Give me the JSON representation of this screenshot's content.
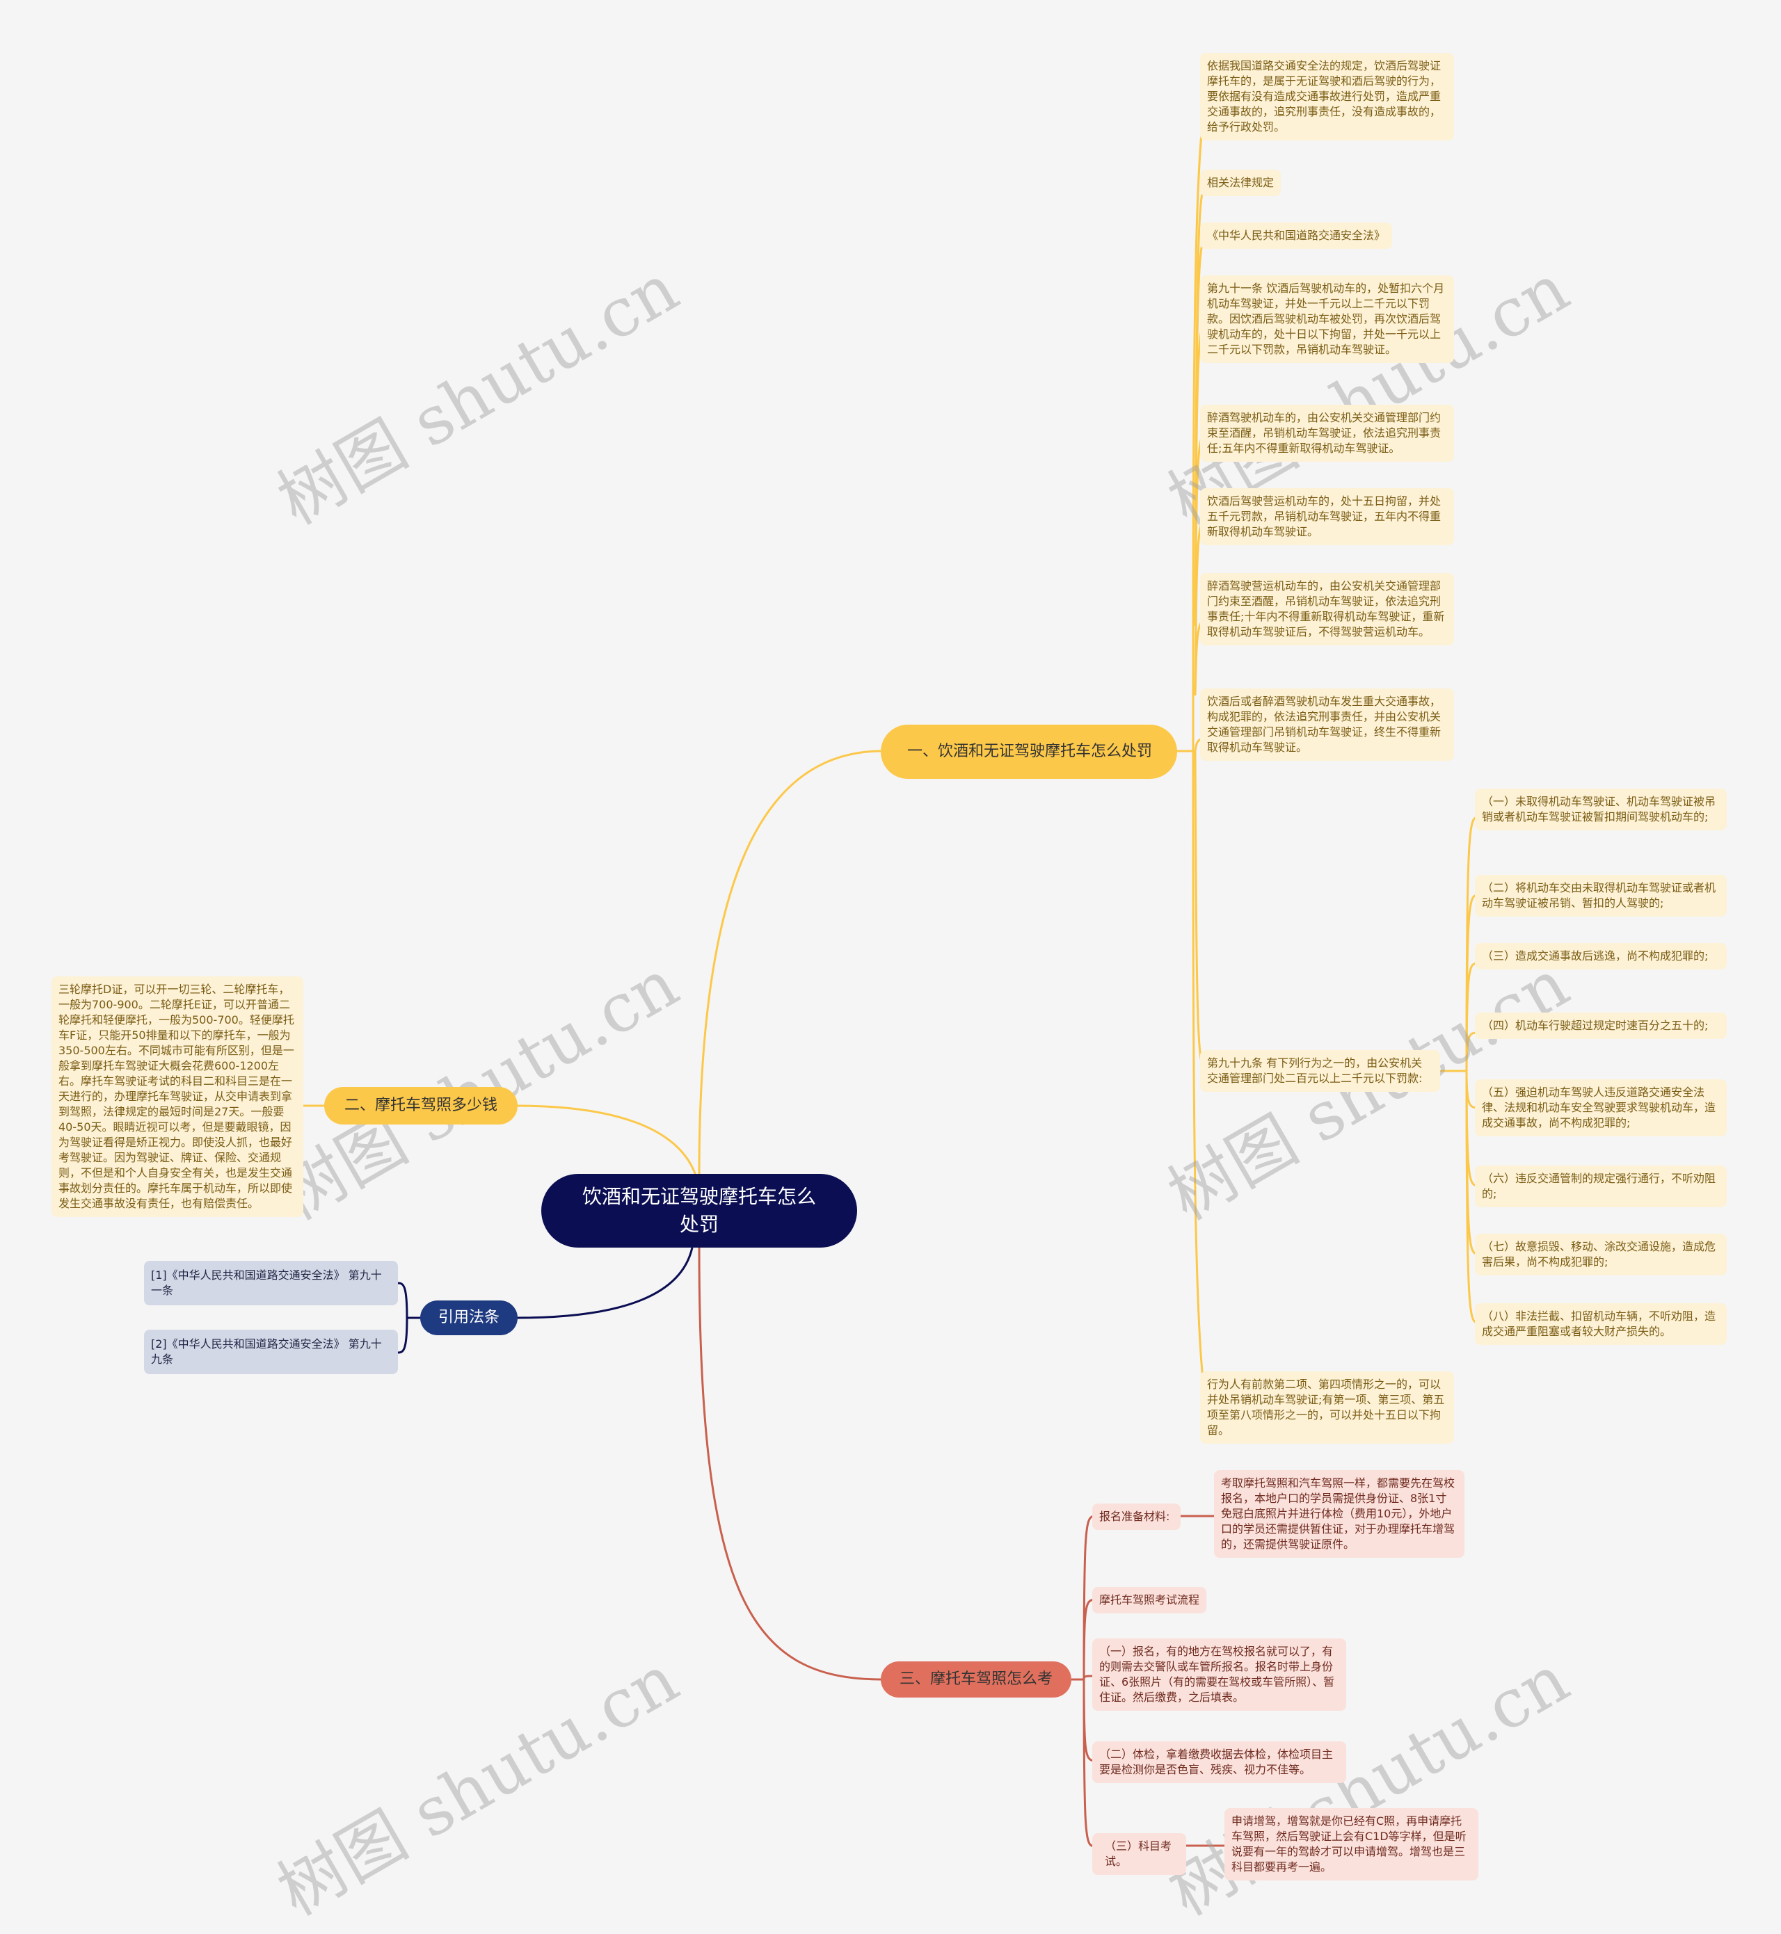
{
  "root": {
    "title": "饮酒和无证驾驶摩托车怎么处罚"
  },
  "colors": {
    "root": "#0b0e52",
    "branch_yellow": "#fcc84a",
    "branch_red": "#e0705d",
    "branch_blue": "#1e3a80",
    "leaf_yellow": "#fdf2d6",
    "leaf_red": "#fae1dc",
    "leaf_blue": "#d3d8e6"
  },
  "branch1": {
    "title": "一、饮酒和无证驾驶摩托车怎么处罚",
    "items": [
      "依据我国道路交通安全法的规定，饮酒后驾驶证摩托车的，是属于无证驾驶和酒后驾驶的行为，要依据有没有造成交通事故进行处罚，造成严重交通事故的，追究刑事责任，没有造成事故的，给予行政处罚。",
      "相关法律规定",
      "《中华人民共和国道路交通安全法》",
      "第九十一条 饮酒后驾驶机动车的，处暂扣六个月机动车驾驶证，并处一千元以上二千元以下罚款。因饮酒后驾驶机动车被处罚，再次饮酒后驾驶机动车的，处十日以下拘留，并处一千元以上二千元以下罚款，吊销机动车驾驶证。",
      "醉酒驾驶机动车的，由公安机关交通管理部门约束至酒醒，吊销机动车驾驶证，依法追究刑事责任;五年内不得重新取得机动车驾驶证。",
      "饮酒后驾驶营运机动车的，处十五日拘留，并处五千元罚款，吊销机动车驾驶证，五年内不得重新取得机动车驾驶证。",
      "醉酒驾驶营运机动车的，由公安机关交通管理部门约束至酒醒，吊销机动车驾驶证，依法追究刑事责任;十年内不得重新取得机动车驾驶证，重新取得机动车驾驶证后，不得驾驶营运机动车。",
      "饮酒后或者醉酒驾驶机动车发生重大交通事故，构成犯罪的，依法追究刑事责任，并由公安机关交通管理部门吊销机动车驾驶证，终生不得重新取得机动车驾驶证。",
      "第九十九条 有下列行为之一的，由公安机关交通管理部门处二百元以上二千元以下罚款:",
      "行为人有前款第二项、第四项情形之一的，可以并处吊销机动车驾驶证;有第一项、第三项、第五项至第八项情形之一的，可以并处十五日以下拘留。"
    ],
    "article99_items": [
      "（一）未取得机动车驾驶证、机动车驾驶证被吊销或者机动车驾驶证被暂扣期间驾驶机动车的;",
      "（二）将机动车交由未取得机动车驾驶证或者机动车驾驶证被吊销、暂扣的人驾驶的;",
      "（三）造成交通事故后逃逸，尚不构成犯罪的;",
      "（四）机动车行驶超过规定时速百分之五十的;",
      "（五）强迫机动车驾驶人违反道路交通安全法律、法规和机动车安全驾驶要求驾驶机动车，造成交通事故，尚不构成犯罪的;",
      "（六）违反交通管制的规定强行通行，不听劝阻的;",
      "（七）故意损毁、移动、涂改交通设施，造成危害后果，尚不构成犯罪的;",
      "（八）非法拦截、扣留机动车辆，不听劝阻，造成交通严重阻塞或者较大财产损失的。"
    ]
  },
  "branch2": {
    "title": "二、摩托车驾照多少钱",
    "text": "三轮摩托D证，可以开一切三轮、二轮摩托车，一般为700-900。二轮摩托E证，可以开普通二轮摩托和轻便摩托，一般为500-700。轻便摩托车F证，只能开50排量和以下的摩托车，一般为350-500左右。不同城市可能有所区别，但是一般拿到摩托车驾驶证大概会花费600-1200左右。摩托车驾驶证考试的科目二和科目三是在一天进行的，办理摩托车驾驶证，从交申请表到拿到驾照，法律规定的最短时间是27天。一般要40-50天。眼睛近视可以考，但是要戴眼镜，因为驾驶证看得是矫正视力。即使没人抓，也最好考驾驶证。因为驾驶证、牌证、保险、交通规则，不但是和个人自身安全有关，也是发生交通事故划分责任的。摩托车属于机动车，所以即使发生交通事故没有责任，也有赔偿责任。"
  },
  "citations": {
    "title": "引用法条",
    "items": [
      "[1]《中华人民共和国道路交通安全法》 第九十一条",
      "[2]《中华人民共和国道路交通安全法》 第九十九条"
    ]
  },
  "branch3": {
    "title": "三、摩托车驾照怎么考",
    "items": [
      {
        "label": "报名准备材料:",
        "detail": "考取摩托驾照和汽车驾照一样，都需要先在驾校报名，本地户口的学员需提供身份证、8张1寸免冠白底照片并进行体检（费用10元），外地户口的学员还需提供暂住证，对于办理摩托车增驾的，还需提供驾驶证原件。"
      },
      {
        "label": "摩托车驾照考试流程"
      },
      {
        "label": "（一）报名，有的地方在驾校报名就可以了，有的则需去交警队或车管所报名。报名时带上身份证、6张照片（有的需要在驾校或车管所照）、暂住证。然后缴费，之后填表。"
      },
      {
        "label": "（二）体检，拿着缴费收据去体检，体检项目主要是检测你是否色盲、残疾、视力不佳等。"
      },
      {
        "label": "（三）科目考试。",
        "detail": "申请增驾，增驾就是你已经有C照，再申请摩托车驾照，然后驾驶证上会有C1D等字样，但是听说要有一年的驾龄才可以申请增驾。增驾也是三科目都要再考一遍。"
      }
    ]
  },
  "watermark": "树图 shutu.cn"
}
